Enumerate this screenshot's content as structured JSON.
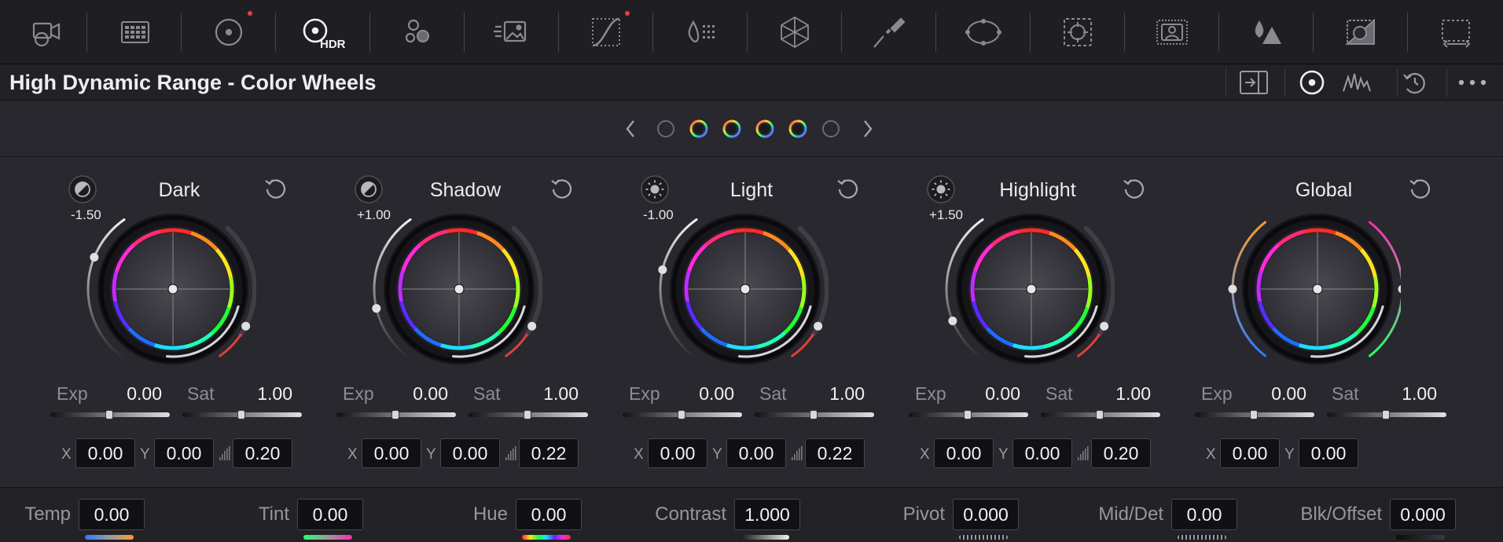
{
  "toolbar": {
    "hdr_label": "HDR",
    "tools": [
      {
        "name": "camera-raw-icon"
      },
      {
        "name": "color-match-icon"
      },
      {
        "name": "primaries-wheels-icon",
        "notify": true
      },
      {
        "name": "hdr-wheels-icon",
        "active": true
      },
      {
        "name": "rgb-mixer-icon"
      },
      {
        "name": "motion-effects-icon"
      },
      {
        "name": "curves-icon",
        "notify": true
      },
      {
        "name": "color-warper-icon"
      },
      {
        "name": "qualifier-icon"
      },
      {
        "name": "window-icon"
      },
      {
        "name": "tracker-icon"
      },
      {
        "name": "magic-mask-icon"
      },
      {
        "name": "blur-icon"
      },
      {
        "name": "key-icon"
      },
      {
        "name": "sizing-icon"
      },
      {
        "name": "3d-icon"
      }
    ]
  },
  "panel": {
    "title": "High Dynamic Range - Color Wheels",
    "header_icons": [
      "zone-panel-icon",
      "wheel-view-icon",
      "graph-view-icon",
      "reset-all-icon",
      "more-options-icon"
    ]
  },
  "nav": {
    "prev_icon": "chevron-left-icon",
    "next_icon": "chevron-right-icon",
    "pages": [
      {
        "style": "empty"
      },
      {
        "style": "color"
      },
      {
        "style": "color"
      },
      {
        "style": "color"
      },
      {
        "style": "color"
      },
      {
        "style": "empty"
      }
    ]
  },
  "wheels": [
    {
      "title": "Dark",
      "value_label": "-1.50",
      "mode_icon": "half-circle-icon",
      "exp_label": "Exp",
      "exp": "0.00",
      "sat_label": "Sat",
      "sat": "1.00",
      "x_label": "X",
      "x": "0.00",
      "y_label": "Y",
      "y": "0.00",
      "falloff": "0.20",
      "range_level": 0.3,
      "left_arc": "mono"
    },
    {
      "title": "Shadow",
      "value_label": "+1.00",
      "mode_icon": "half-circle-icon",
      "exp_label": "Exp",
      "exp": "0.00",
      "sat_label": "Sat",
      "sat": "1.00",
      "x_label": "X",
      "x": "0.00",
      "y_label": "Y",
      "y": "0.00",
      "falloff": "0.22",
      "range_level": 0.62,
      "left_arc": "mono"
    },
    {
      "title": "Light",
      "value_label": "-1.00",
      "mode_icon": "sun-icon",
      "exp_label": "Exp",
      "exp": "0.00",
      "sat_label": "Sat",
      "sat": "1.00",
      "x_label": "X",
      "x": "0.00",
      "y_label": "Y",
      "y": "0.00",
      "falloff": "0.22",
      "range_level": 0.38,
      "left_arc": "mono"
    },
    {
      "title": "Highlight",
      "value_label": "+1.50",
      "mode_icon": "sun-icon",
      "exp_label": "Exp",
      "exp": "0.00",
      "sat_label": "Sat",
      "sat": "1.00",
      "x_label": "X",
      "x": "0.00",
      "y_label": "Y",
      "y": "0.00",
      "falloff": "0.20",
      "range_level": 0.7,
      "left_arc": "mono"
    },
    {
      "title": "Global",
      "value_label": "",
      "mode_icon": "",
      "exp_label": "Exp",
      "exp": "0.00",
      "sat_label": "Sat",
      "sat": "1.00",
      "x_label": "X",
      "x": "0.00",
      "y_label": "Y",
      "y": "0.00",
      "falloff": "",
      "range_level": 0.5,
      "left_arc": "temp"
    }
  ],
  "adjust": [
    {
      "label": "Temp",
      "value": "0.00",
      "strip": "temp"
    },
    {
      "label": "Tint",
      "value": "0.00",
      "strip": "tint"
    },
    {
      "label": "Hue",
      "value": "0.00",
      "strip": "hue"
    },
    {
      "label": "Contrast",
      "value": "1.000",
      "strip": "mono"
    },
    {
      "label": "Pivot",
      "value": "0.000",
      "strip": "dots"
    },
    {
      "label": "Mid/Det",
      "value": "0.00",
      "strip": "dots"
    },
    {
      "label": "Blk/Offset",
      "value": "0.000",
      "strip": "dark"
    }
  ],
  "colors": {
    "accent": "#e0404a",
    "panel_bg": "#28282e",
    "field_bg": "#111114"
  }
}
